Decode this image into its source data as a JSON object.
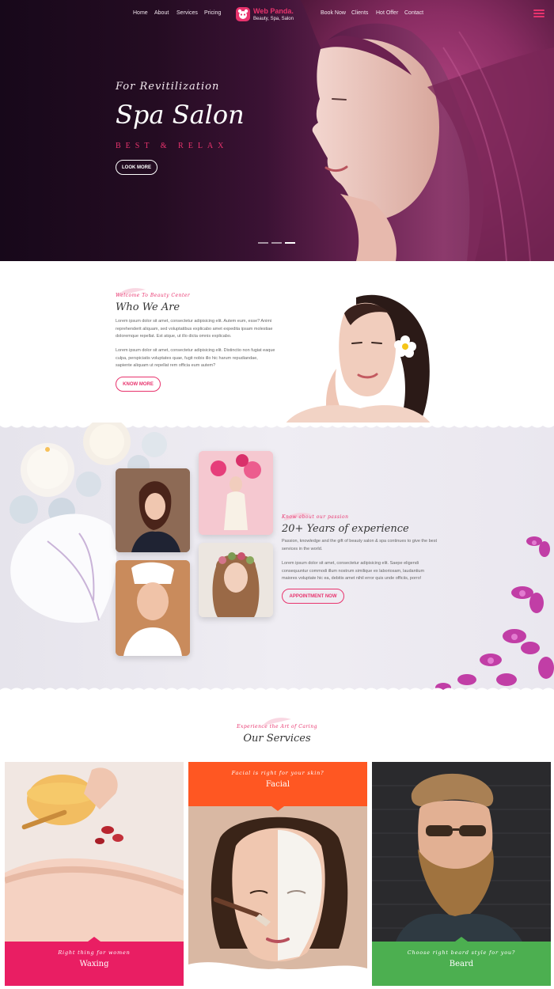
{
  "nav": {
    "left": [
      "Home",
      "About",
      "Services",
      "Pricing"
    ],
    "right": [
      "Book Now",
      "Clients",
      "Hot Offer",
      "Contact"
    ],
    "logo_title": "Web Panda.",
    "logo_subtitle": "Beauty, Spa, Salon"
  },
  "hero": {
    "pre": "For Revitilization",
    "title": "Spa Salon",
    "tagline": "BEST & RELAX",
    "button": "LOOK MORE",
    "slides_total": 3,
    "slide_active": 3
  },
  "about": {
    "pre": "Welcome To Beauty Center",
    "title": "Who We Are",
    "p1": "Lorem ipsum dolor sit amet, consectetur adipisicing elit. Autem eum, esse? Animi reprehenderit aliquam, sed voluptatibus explicabo amet expedita ipsam molestiae doloremque repellat. Est atque, ut illo dicta omnis explicabo.",
    "p2": "Lorem ipsum dolor sit amet, consectetur adipisicing elit. Distinctio non fugiat eaque culpa, perspiciatis voluptates quae, fugit nobis illo hic harum repudiandae, sapiente aliquam ut repellat rem officia eum autem?",
    "button": "KNOW MORE"
  },
  "experience": {
    "pre": "Know about our passion",
    "title": "20+ Years of experience",
    "p1": "Passion, knowledge and the gift of beauty salon & spa continues to give the best services in the world.",
    "p2": "Lorem ipsum dolor sit amet, consectetur adipisicing elit. Saepe eligendi consequuntur commodi illum nostrum similique ex laboriosam, laudantium maiores voluptate hic ea, debitis amet nihil error quis unde officiis, porro!",
    "button": "APPOINTMENT NOW"
  },
  "services": {
    "pre": "Experience the Art of Caring",
    "title": "Our Services",
    "cards": [
      {
        "sub": "Right thing for women",
        "name": "Waxing",
        "color": "#e91e63"
      },
      {
        "sub": "Facial is right for your skin?",
        "name": "Facial",
        "color": "#ff5722"
      },
      {
        "sub": "Choose right beard style for you?",
        "name": "Beard",
        "color": "#4caf50"
      }
    ]
  },
  "colors": {
    "accent": "#e8336d",
    "hero_bg": "#2a0e27"
  }
}
